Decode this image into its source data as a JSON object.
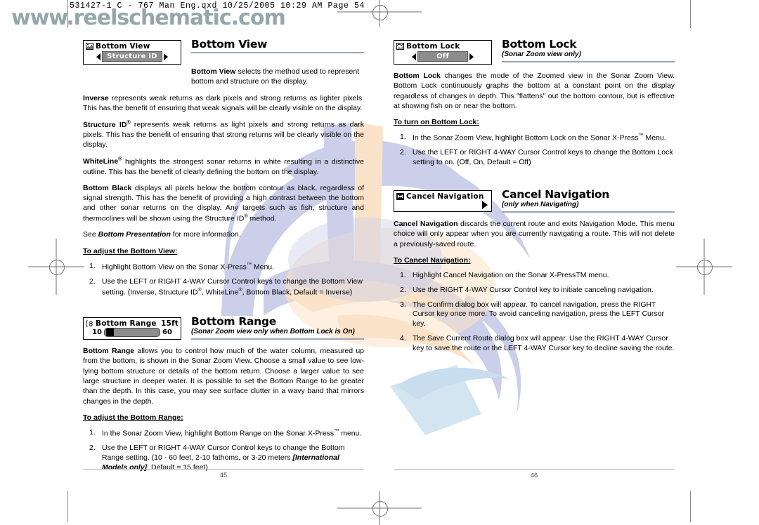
{
  "header": {
    "qxd_line": "531427-1  C - 767 Man Eng.qxd   10/25/2005   10:29 AM   Page 54",
    "watermark_url": "www.reelschematic.com"
  },
  "colors": {
    "rule": "#9aa6b4",
    "watermark_text": "#8fa3a6",
    "watermark_art_blue": "#b9bfe0",
    "watermark_art_peach": "#fadfc0",
    "menu_chip": "#8c8c8c"
  },
  "left_page": {
    "page_number": "45",
    "sections": [
      {
        "menu": {
          "icon": "bottom-view-icon",
          "label": "Bottom View",
          "type": "selector",
          "value": "Structure ID",
          "left_arrow": "left-arrow-icon",
          "right_arrow": "right-arrow-icon"
        },
        "title": "Bottom View",
        "subtitle": "",
        "first_para_html": "<b>Bottom View</b> selects the method used to represent bottom and structure on the display.",
        "paragraphs": [
          "<b>Inverse</b> represents weak returns as dark pixels and strong returns as lighter pixels. This has the benefit of ensuring that weak signals will be clearly visible on the display.",
          "<b>Structure ID<span class='sup'>®</span></b> represents weak returns as light pixels and strong returns as dark pixels.  This has the benefit of ensuring that strong returns will be clearly visible on the display.",
          "<b>WhiteLine<span class='sup'>®</span></b> highlights the strongest sonar returns in white resulting in a distinctive outline.  This has the benefit of clearly defining the bottom on the display.",
          "<b>Bottom Black</b> displays all pixels below the bottom contour as black, regardless of signal strength. This has the benefit of providing a high contrast between the bottom and other sonar returns on the display. Any targets such as fish, structure and thermoclines will be shown using the Structure ID<span class='sup'>®</span> method.",
          "See <b><i>Bottom Presentation</i></b> for more information."
        ],
        "procedure_heading": "To adjust the Bottom View:",
        "steps": [
          "Highlight Bottom View on the Sonar X-Press<span class='sup'>™</span> Menu.",
          "Use the LEFT or RIGHT 4-WAY Cursor Control keys to change the Bottom View setting. (Inverse, Structure ID<span class='sup'>®</span>, WhiteLine<span class='sup'>®</span>, Bottom Black, Default = Inverse)"
        ]
      },
      {
        "menu": {
          "icon": "bottom-range-icon",
          "label": "Bottom Range",
          "type": "slider",
          "value": "15ft",
          "slider_min": "10",
          "slider_max": "60"
        },
        "title": "Bottom Range",
        "subtitle": "(Sonar Zoom view only when Bottom Lock is On)",
        "first_para_html": "",
        "paragraphs": [
          "<b>Bottom Range</b> allows you to control how much of the water column, measured up from the bottom, is shown in the Sonar Zoom View. Choose a small value to see low-lying bottom structure or details of the bottom return. Choose a larger value to see large structure in deeper water. It is possible to set the Bottom Range to be greater than the depth. In this case, you may see surface clutter in a wavy band that mirrors changes in the depth."
        ],
        "procedure_heading": "To adjust the Bottom Range:",
        "steps": [
          "In the Sonar Zoom View, highlight Bottom Range on the Sonar X-Press<span class='sup'>™</span> menu.",
          "Use the LEFT or RIGHT 4-WAY Cursor Control keys to change the Bottom Range setting. (10 - 60 feet, 2-10 fathoms, or 3-20 meters <b><i>[International Models only]</i></b>, Default = 15 feet)"
        ]
      }
    ]
  },
  "right_page": {
    "page_number": "46",
    "sections": [
      {
        "menu": {
          "icon": "bottom-lock-icon",
          "label": "Bottom Lock",
          "type": "selector",
          "value": "Off",
          "left_arrow": "left-arrow-icon",
          "right_arrow": "right-arrow-icon"
        },
        "title": "Bottom Lock",
        "subtitle": "(Sonar Zoom view only)",
        "first_para_html": "",
        "paragraphs": [
          "<b>Bottom Lock</b> changes the mode of the Zoomed view in the Sonar Zoom View. Bottom Lock continuously graphs the bottom at a constant point on the display regardless of changes in depth. This \"flattens\" out the bottom contour, but is effective at showing fish on or near the bottom."
        ],
        "procedure_heading": "To turn on Bottom Lock:",
        "steps": [
          "In the Sonar Zoom View, highlight Bottom Lock on the Sonar X-Press<span class='sup'>™</span> Menu.",
          "Use the LEFT or RIGHT 4-WAY Cursor Control keys to change the Bottom Lock setting to on. (Off, On, Default = Off)"
        ]
      },
      {
        "menu": {
          "icon": "cancel-navigation-icon",
          "label": "Cancel Navigation",
          "type": "submenu",
          "value": "",
          "right_arrow": "right-arrow-icon"
        },
        "title": "Cancel Navigation",
        "subtitle": "(only when Navigating)",
        "first_para_html": "",
        "paragraphs": [
          "<b>Cancel Navigation</b> discards the current route and exits Navigation Mode. This menu choice will only appear when you are currently navigating a route. This will not delete a previously-saved route."
        ],
        "procedure_heading": "To Cancel Navigation:",
        "steps": [
          "Highlight Cancel Navigation on the Sonar X-PressTM menu.",
          "Use the RIGHT 4-WAY Cursor Control key to initiate canceling navigation.",
          "The Confirm dialog box will appear. To cancel navigation,  press the RIGHT Cursor key once more. To avoid canceling navigation, press the LEFT Cursor key.",
          "The Save Current Route dialog box will appear.  Use the RIGHT 4-WAY Cursor key to save the route or the LEFT 4-WAY Cursor key to decline saving the route."
        ]
      }
    ]
  }
}
